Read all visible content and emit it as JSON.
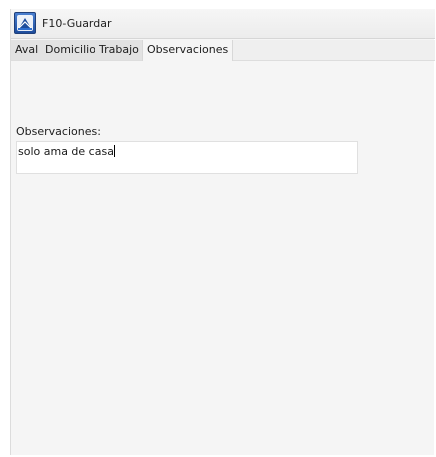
{
  "window": {
    "title": "F10-Guardar",
    "icon": "app-logo-icon"
  },
  "tabs": [
    {
      "label": "Aval",
      "active": false
    },
    {
      "label": "Domicilio",
      "active": false
    },
    {
      "label": "Trabajo",
      "active": false
    },
    {
      "label": "Observaciones",
      "active": true
    }
  ],
  "observaciones": {
    "label": "Observaciones:",
    "value": "solo ama de casa"
  },
  "colors": {
    "icon_blue": "#2a5db0",
    "active_tab": "#f5f5f5",
    "inactive_tab": "#e2e2e2"
  }
}
